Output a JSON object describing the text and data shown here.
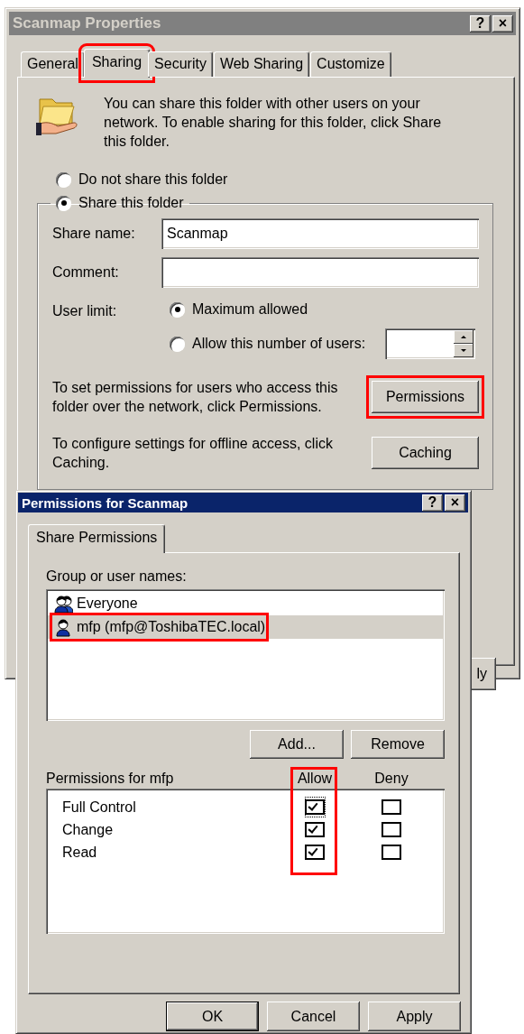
{
  "properties_window": {
    "title": "Scanmap Properties",
    "active": false,
    "title_buttons": [
      "?",
      "×"
    ],
    "tabs": [
      {
        "label": "General",
        "selected": false,
        "highlighted": false
      },
      {
        "label": "Sharing",
        "selected": true,
        "highlighted": true
      },
      {
        "label": "Security",
        "selected": false,
        "highlighted": false
      },
      {
        "label": "Web Sharing",
        "selected": false,
        "highlighted": false
      },
      {
        "label": "Customize",
        "selected": false,
        "highlighted": false
      }
    ],
    "intro": "You can share this folder with other users on your network.  To enable sharing for this folder, click Share this folder.",
    "sharing_options": [
      {
        "label": "Do not share this folder",
        "selected": false
      },
      {
        "label": "Share this folder",
        "selected": true
      }
    ],
    "share_name": {
      "label": "Share name:",
      "value": "Scanmap"
    },
    "comment": {
      "label": "Comment:"
    },
    "user_limit": {
      "label": "User limit:",
      "options": [
        {
          "label": "Maximum allowed",
          "selected": true
        },
        {
          "label": "Allow this number of users:",
          "selected": false
        }
      ]
    },
    "permissions_text": "To set permissions for users who access this folder over the network, click Permissions.",
    "permissions_button": {
      "label": "Permissions",
      "highlighted": true
    },
    "caching_text": "To configure settings for offline access, click Caching.",
    "caching_button": {
      "label": "Caching",
      "highlighted": false
    },
    "covered_button": "ly"
  },
  "permissions_window": {
    "title": "Permissions for Scanmap",
    "active": true,
    "title_buttons": [
      "?",
      "×"
    ],
    "tabs": [
      {
        "label": "Share Permissions",
        "selected": true
      }
    ],
    "users_label": "Group or user names:",
    "users": [
      {
        "name": "Everyone",
        "kind": "group",
        "selected": false,
        "highlighted": false
      },
      {
        "name": "mfp (mfp@ToshibaTEC.local)",
        "kind": "user",
        "selected": true,
        "highlighted": true
      }
    ],
    "user_buttons": [
      "Add...",
      "Remove"
    ],
    "permissions_label": "Permissions for mfp",
    "columns": [
      {
        "label": "Allow",
        "highlighted": true
      },
      {
        "label": "Deny",
        "highlighted": false
      }
    ],
    "permissions": [
      {
        "name": "Full Control",
        "allow": true,
        "deny": false,
        "focused": true
      },
      {
        "name": "Change",
        "allow": true,
        "deny": false,
        "focused": false
      },
      {
        "name": "Read",
        "allow": true,
        "deny": false,
        "focused": false
      }
    ],
    "footer_buttons": [
      {
        "label": "OK",
        "default": true
      },
      {
        "label": "Cancel",
        "default": false
      },
      {
        "label": "Apply",
        "default": false
      }
    ]
  }
}
